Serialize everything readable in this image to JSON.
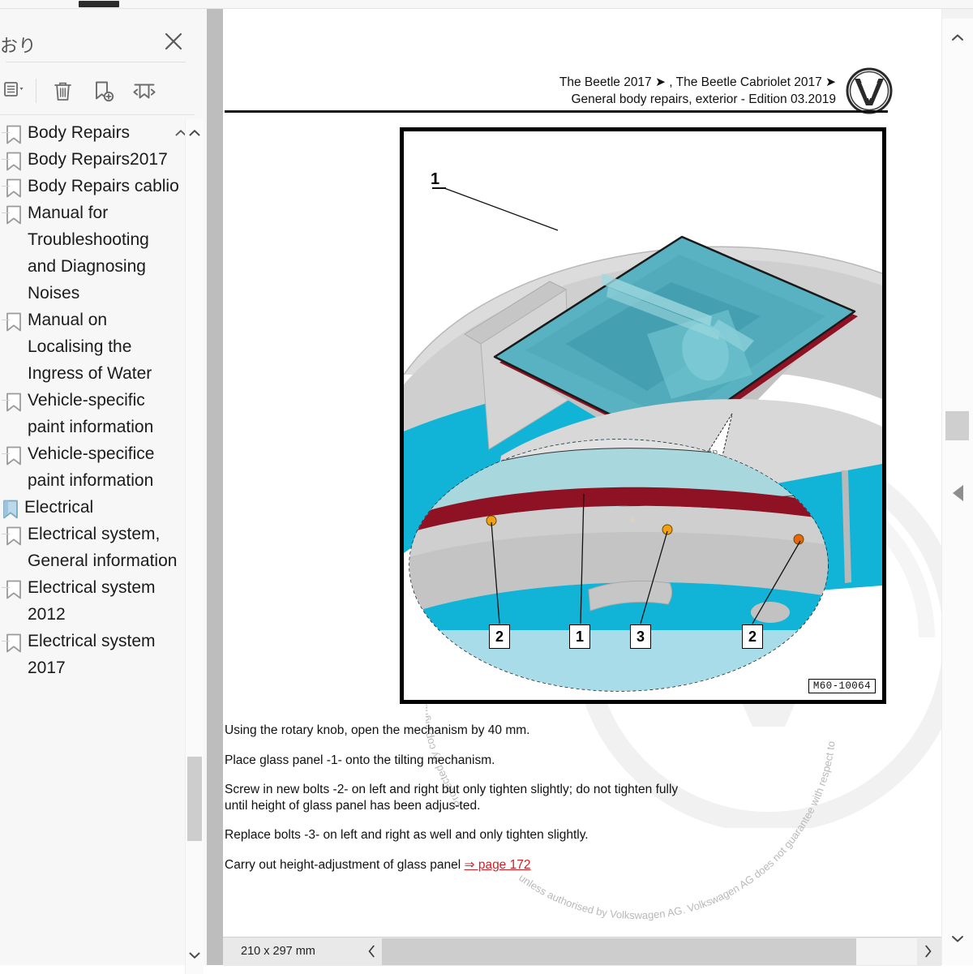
{
  "window": {
    "tab_indicator": ""
  },
  "sidebar": {
    "title": "おり",
    "close_icon": "close-icon",
    "toolbar": [
      {
        "name": "options-list-dropdown",
        "icon": "list-dropdown-icon",
        "label": "Options"
      },
      {
        "name": "delete-bookmark",
        "icon": "trash-icon",
        "label": "Delete"
      },
      {
        "name": "add-bookmark",
        "icon": "bookmark-add-icon",
        "label": "Add bookmark"
      },
      {
        "name": "move-bookmark",
        "icon": "bookmark-move-icon",
        "label": "Move bookmark"
      }
    ],
    "items": [
      {
        "label": "Body Repairs",
        "type": "bookmark",
        "level": 1
      },
      {
        "label": "Body Repairs2017",
        "type": "bookmark",
        "level": 1
      },
      {
        "label": "Body Repairs cablio",
        "type": "bookmark",
        "level": 1
      },
      {
        "label": "Manual for Troubleshooting and Diagnosing Noises",
        "type": "bookmark",
        "level": 1
      },
      {
        "label": "Manual on Localising the Ingress of Water",
        "type": "bookmark",
        "level": 1
      },
      {
        "label": "Vehicle-specific paint information",
        "type": "bookmark",
        "level": 1
      },
      {
        "label": "Vehicle-specifice paint information",
        "type": "bookmark",
        "level": 1
      },
      {
        "label": "Electrical",
        "type": "folder",
        "level": 0
      },
      {
        "label": "Electrical system, General information",
        "type": "bookmark",
        "level": 1
      },
      {
        "label": "Electrical system 2012",
        "type": "bookmark",
        "level": 1
      },
      {
        "label": "Electrical system 2017",
        "type": "bookmark",
        "level": 1
      }
    ],
    "scrollbar": {
      "up_icon": "chevron-up-icon",
      "down_icon": "chevron-down-icon"
    }
  },
  "gutter": {
    "prev_page_icon": "triangle-left-icon"
  },
  "document": {
    "header_line1": "The Beetle 2017 ➤ , The Beetle Cabriolet 2017 ➤",
    "header_line2": "General body repairs, exterior - Edition 03.2019",
    "logo": "vw-logo",
    "figure": {
      "id": "M60-10064",
      "callouts": [
        {
          "label": "1",
          "position": "top-left-leader"
        },
        {
          "label": "2",
          "position": "detail-left"
        },
        {
          "label": "1",
          "position": "detail-center-left"
        },
        {
          "label": "3",
          "position": "detail-center-right"
        },
        {
          "label": "2",
          "position": "detail-right"
        }
      ]
    },
    "watermark": "Protected by copyright. Copying for private or commercial purposes, in part or in whole, is not permitted unless authorised by Volkswagen AG. Volkswagen AG does not guarantee or accept any liability with respect to the correctness of information in this document. Copyright by Volkswagen AG.",
    "paragraphs": [
      {
        "text": "Using the rotary knob, open the mechanism by 40 mm."
      },
      {
        "text": "Place glass panel -1- onto the tilting mechanism."
      },
      {
        "text": "Screw in new bolts -2- on left and right but only tighten slightly; do not tighten fully until height of glass panel has been adjus-ted."
      },
      {
        "text": "Replace bolts -3- on left and right as well and only tighten slightly."
      },
      {
        "text": "Carry out height-adjustment of glass panel ",
        "link": "⇒ page 172"
      }
    ]
  },
  "statusbar": {
    "page_size": "210 x 297 mm",
    "scroll_left_icon": "chevron-left-icon",
    "scroll_right_icon": "chevron-right-icon"
  },
  "window_scrollbar": {
    "up_icon": "chevron-up-icon",
    "down_icon": "chevron-down-icon",
    "prev_icon": "triangle-left-icon"
  },
  "colors": {
    "accent_red": "#d21f26",
    "glass_teal": "#5fb6c4",
    "body_cyan": "#11b4d6",
    "seal_maroon": "#8e1224",
    "panel_bg": "#f7f7f7"
  }
}
